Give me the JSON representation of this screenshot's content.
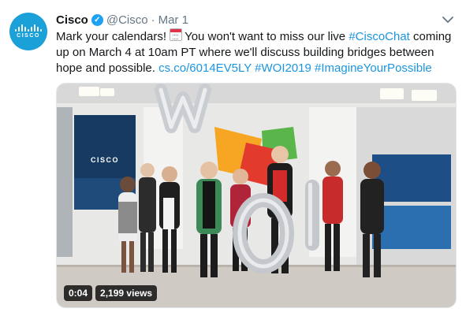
{
  "tweet": {
    "author_name": "Cisco",
    "handle": "@Cisco",
    "separator": "·",
    "date": "Mar 1",
    "avatar_text": "CISCO",
    "text_part1": "Mark your calendars!",
    "text_part2": "You won't want to miss our live",
    "hashtag1": "#CiscoChat",
    "text_part3": "coming up on March 4 at 10am PT where we'll discuss building bridges between hope and possible.",
    "link": "cs.co/6014EV5LY",
    "hashtag2": "#WOI2019",
    "hashtag3": "#ImagineYourPossible"
  },
  "video": {
    "duration": "0:04",
    "views": "2,199 views",
    "screen_logo": "CISCO",
    "balloon_text": "WO"
  },
  "icons": {
    "verified": "verified-badge-icon",
    "caret": "chevron-down-icon",
    "calendar": "calendar-emoji-icon"
  },
  "colors": {
    "link": "#1b95e0",
    "verified": "#1da1f2",
    "avatar_bg": "#1ba0d7"
  }
}
